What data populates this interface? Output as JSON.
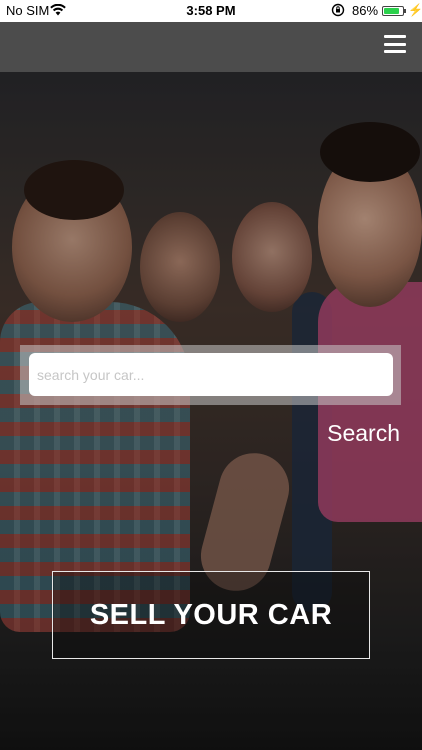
{
  "status_bar": {
    "carrier": "No SIM",
    "time": "3:58 PM",
    "battery_percent": "86%",
    "battery_level": 0.86,
    "wifi_icon": "wifi-icon",
    "orientation_lock_icon": "orientation-lock-icon",
    "charging_icon": "charging-bolt-icon"
  },
  "navbar": {
    "menu_icon": "hamburger-menu-icon"
  },
  "search": {
    "placeholder": "search your car...",
    "value": "",
    "button_label": "Search"
  },
  "sell": {
    "label": "SELL YOUR CAR"
  },
  "colors": {
    "navbar_bg": "#4c4c4c",
    "battery_green": "#2bd14c",
    "text_white": "#ffffff"
  }
}
